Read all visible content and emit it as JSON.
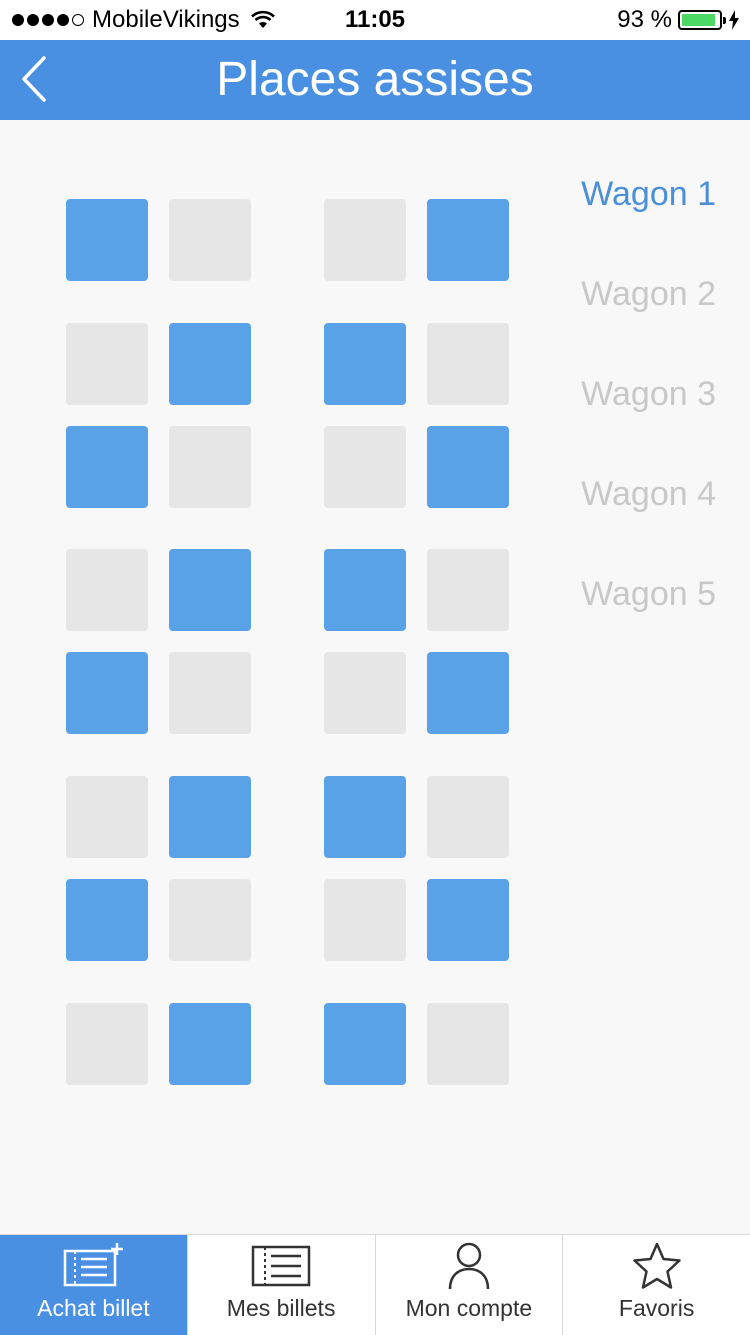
{
  "status_bar": {
    "carrier": "MobileVikings",
    "time": "11:05",
    "battery": "93 %"
  },
  "nav": {
    "title": "Places assises",
    "back_icon": "chevron-left-icon"
  },
  "colors": {
    "accent": "#4a90e2",
    "seat_available": "#5aa2e8",
    "seat_taken": "#e6e6e6",
    "wagon_inactive": "#c8c8c8"
  },
  "seats": [
    [
      "available",
      "taken",
      "taken",
      "available"
    ],
    [
      "taken",
      "available",
      "available",
      "taken"
    ],
    [
      "available",
      "taken",
      "taken",
      "available"
    ],
    [
      "taken",
      "available",
      "available",
      "taken"
    ],
    [
      "available",
      "taken",
      "taken",
      "available"
    ],
    [
      "taken",
      "available",
      "available",
      "taken"
    ],
    [
      "available",
      "taken",
      "taken",
      "available"
    ],
    [
      "taken",
      "available",
      "available",
      "taken"
    ]
  ],
  "wagons": {
    "items": [
      "Wagon 1",
      "Wagon 2",
      "Wagon 3",
      "Wagon 4",
      "Wagon 5"
    ],
    "selected": "Wagon 1"
  },
  "tabs": [
    {
      "label": "Achat billet",
      "icon": "ticket-add-icon",
      "active": true
    },
    {
      "label": "Mes billets",
      "icon": "ticket-icon",
      "active": false
    },
    {
      "label": "Mon compte",
      "icon": "user-icon",
      "active": false
    },
    {
      "label": "Favoris",
      "icon": "star-icon",
      "active": false
    }
  ]
}
